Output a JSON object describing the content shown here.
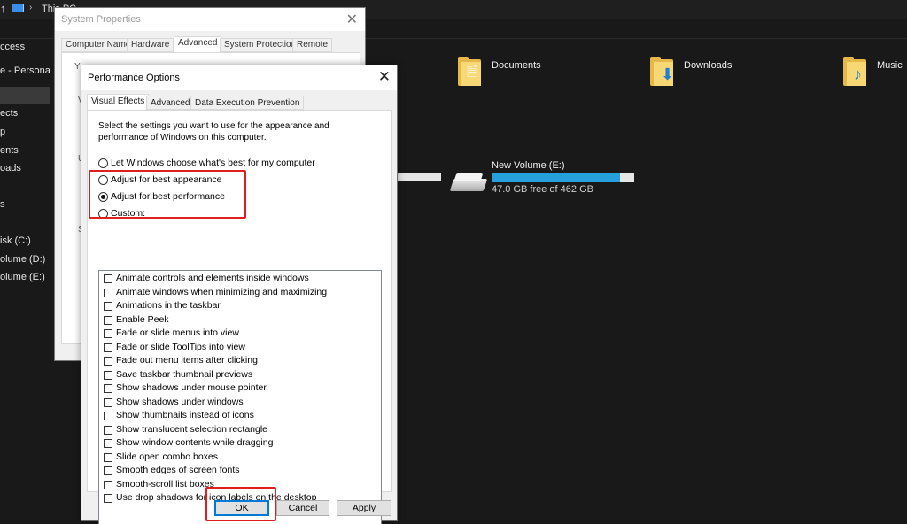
{
  "explorer": {
    "breadcrumb": "This PC",
    "nav_items": [
      "ccess",
      "e - Personal",
      "",
      "ects",
      "p",
      "ents",
      "oads",
      "s",
      "isk (C:)",
      "olume (D:)",
      "olume (E:)"
    ],
    "folders": [
      {
        "label": "Documents",
        "icon": "documents-folder-icon"
      },
      {
        "label": "Downloads",
        "icon": "downloads-folder-icon"
      },
      {
        "label": "Music",
        "icon": "music-folder-icon"
      }
    ],
    "drive": {
      "name": "New Volume (E:)",
      "free_text": "47.0 GB free of 462 GB",
      "used_fraction": 0.9,
      "bar_color": "#26a0da"
    }
  },
  "system_properties": {
    "title": "System Properties",
    "tabs": [
      "Computer Name",
      "Hardware",
      "Advanced",
      "System Protection",
      "Remote"
    ],
    "active_tab": "Advanced",
    "faint_letters": [
      "Y",
      "V",
      "U",
      "S"
    ]
  },
  "performance_options": {
    "title": "Performance Options",
    "tabs": [
      "Visual Effects",
      "Advanced",
      "Data Execution Prevention"
    ],
    "active_tab": "Visual Effects",
    "description": "Select the settings you want to use for the appearance and performance of Windows on this computer.",
    "radio_options": [
      {
        "label": "Let Windows choose what's best for my computer",
        "checked": false
      },
      {
        "label": "Adjust for best appearance",
        "checked": false
      },
      {
        "label": "Adjust for best performance",
        "checked": true
      },
      {
        "label": "Custom:",
        "checked": false
      }
    ],
    "checkboxes": [
      "Animate controls and elements inside windows",
      "Animate windows when minimizing and maximizing",
      "Animations in the taskbar",
      "Enable Peek",
      "Fade or slide menus into view",
      "Fade or slide ToolTips into view",
      "Fade out menu items after clicking",
      "Save taskbar thumbnail previews",
      "Show shadows under mouse pointer",
      "Show shadows under windows",
      "Show thumbnails instead of icons",
      "Show translucent selection rectangle",
      "Show window contents while dragging",
      "Slide open combo boxes",
      "Smooth edges of screen fonts",
      "Smooth-scroll list boxes",
      "Use drop shadows for icon labels on the desktop"
    ],
    "buttons": {
      "ok": "OK",
      "cancel": "Cancel",
      "apply": "Apply"
    },
    "highlight_color": "#e01f1f"
  }
}
